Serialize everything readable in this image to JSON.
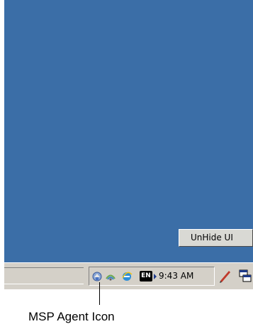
{
  "desktop": {
    "background_color": "#3b6ea7"
  },
  "unhide_button": {
    "label": "UnHide UI"
  },
  "taskbar": {
    "tray": {
      "icons": [
        "msp-agent-icon",
        "network-icon",
        "internet-explorer-icon"
      ],
      "language": "EN",
      "clock": "9:43 AM"
    },
    "right_icons": [
      "pen-input-icon",
      "window-switch-icon"
    ]
  },
  "annotation": {
    "label": "MSP Agent Icon"
  }
}
